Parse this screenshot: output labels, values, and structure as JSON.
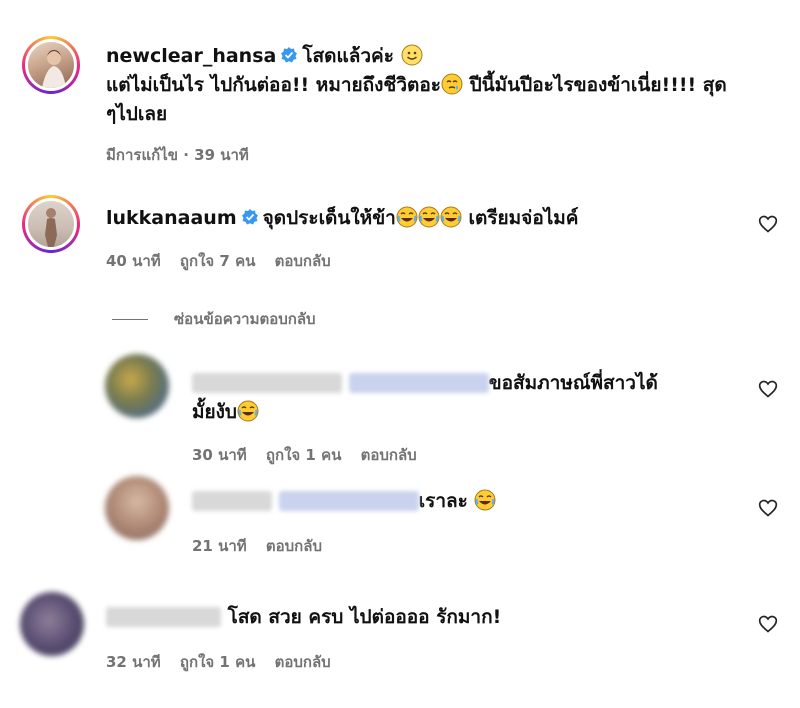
{
  "comments": [
    {
      "username": "newclear_hansa",
      "text1": "โสดแล้วค่ะ",
      "text2": "แต่ไม่เป็นไร ไปกันต่ออ!! หมายถึงชีวิตอะ",
      "text3": "ปีนี้มันปีอะไรของข้าเนี่ย!!!! สุด",
      "text4": "ๆไปเลย",
      "meta": "มีการแก้ไข · 39 นาที"
    },
    {
      "username": "lukkanaaum",
      "text": "จุดประเด็นให้ข้า",
      "text_after": "เตรียมจ่อไมค์",
      "time": "40 นาที",
      "likes": "ถูกใจ 7 คน",
      "reply": "ตอบกลับ"
    }
  ],
  "hide_replies": "ซ่อนข้อความตอบกลับ",
  "replies": [
    {
      "text1": "ขอสัมภาษณ์พี่สาวได้",
      "text2": "มั้ยงับ",
      "time": "30 นาที",
      "likes": "ถูกใจ 1 คน",
      "reply": "ตอบกลับ"
    },
    {
      "text": "เราละ",
      "time": "21 นาที",
      "reply": "ตอบกลับ"
    }
  ],
  "last_comment": {
    "text": "โสด สวย ครบ ไปต่ออออ รักมาก!",
    "time": "32 นาที",
    "likes": "ถูกใจ 1 คน",
    "reply": "ตอบกลับ"
  },
  "icons": {
    "verified_color": "#3897f0",
    "heart": "heart-outline-icon"
  }
}
